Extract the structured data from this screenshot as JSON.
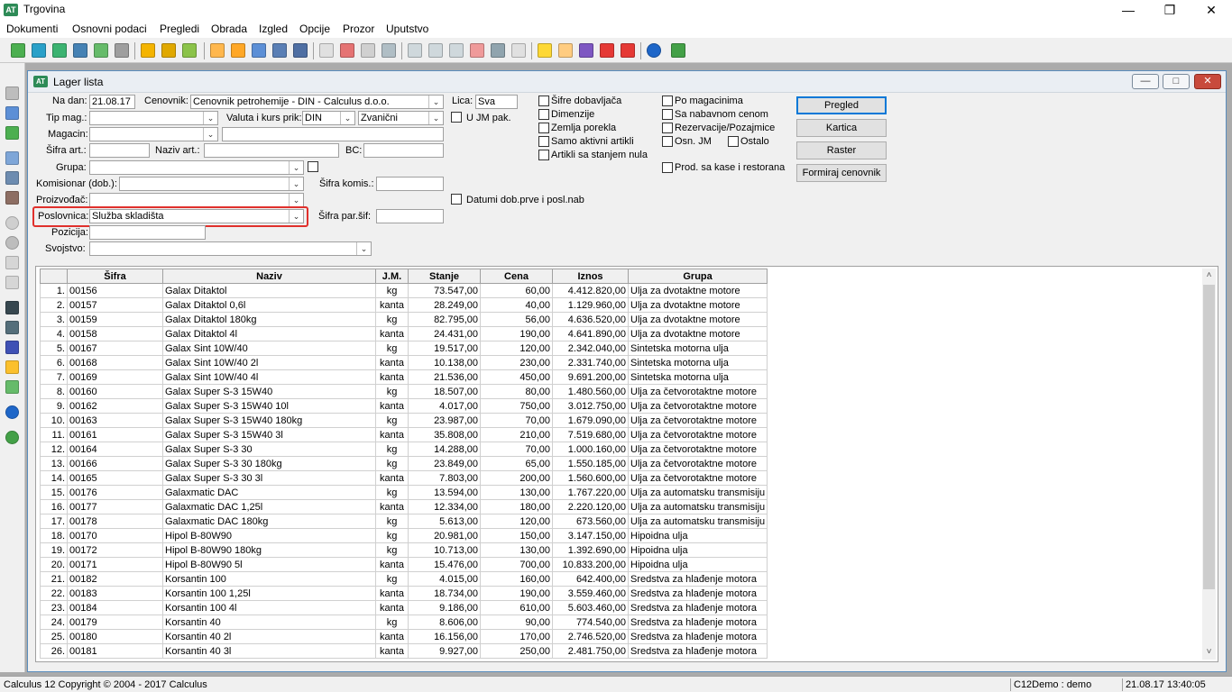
{
  "app": {
    "title": "Trgovina",
    "icon_text": "AT"
  },
  "menu": [
    "Dokumenti",
    "Osnovni podaci",
    "Pregledi",
    "Obrada",
    "Izgled",
    "Opcije",
    "Prozor",
    "Uputstvo"
  ],
  "child": {
    "title": "Lager lista"
  },
  "form": {
    "na_dan_label": "Na dan:",
    "na_dan_value": "21.08.17",
    "cenovnik_label": "Cenovnik:",
    "cenovnik_value": "Cenovnik petrohemije - DIN - Calculus d.o.o.",
    "lica_label": "Lica:",
    "lica_value": "Sva",
    "tip_mag_label": "Tip mag.:",
    "tip_mag_value": "",
    "valuta_label": "Valuta i kurs prik:",
    "valuta_value": "DIN",
    "kurs_value": "Zvanični",
    "u_jm_pak_label": "U JM pak.",
    "magacin_label": "Magacin:",
    "magacin_value": "",
    "sifra_art_label": "Šifra art.:",
    "naziv_art_label": "Naziv art.:",
    "bc_label": "BC:",
    "grupa_label": "Grupa:",
    "grupa_value": "",
    "komisionar_label": "Komisionar (dob.):",
    "komisionar_value": "",
    "sifra_komis_label": "Šifra komis.:",
    "proizvodjac_label": "Proizvođač:",
    "proizvodjac_value": "",
    "datumi_label": "Datumi dob.prve i posl.nab",
    "poslovnica_label": "Poslovnica:",
    "poslovnica_value": "Služba skladišta",
    "sifra_par_label": "Šifra par.šif:",
    "pozicija_label": "Pozicija:",
    "pozicija_value": "",
    "svojstvo_label": "Svojstvo:",
    "svojstvo_value": ""
  },
  "checks_col1": [
    "Šifre dobavljača",
    "Dimenzije",
    "Zemlja porekla",
    "Samo aktivni artikli",
    "Artikli sa stanjem nula"
  ],
  "checks_col2": [
    "Po magacinima",
    "Sa nabavnom cenom",
    "Rezervacije/Pozajmice",
    "Osn. JM",
    "Ostalo",
    "Prod. sa kase i restorana"
  ],
  "buttons": {
    "pregled": "Pregled",
    "kartica": "Kartica",
    "raster": "Raster",
    "formiraj": "Formiraj cenovnik"
  },
  "grid": {
    "columns": [
      "",
      "Šifra",
      "Naziv",
      "J.M.",
      "Stanje",
      "Cena",
      "Iznos",
      "Grupa"
    ],
    "rows": [
      [
        "1.",
        "00156",
        "Galax Ditaktol",
        "kg",
        "73.547,00",
        "60,00",
        "4.412.820,00",
        "Ulja za dvotaktne motore"
      ],
      [
        "2.",
        "00157",
        "Galax Ditaktol 0,6l",
        "kanta",
        "28.249,00",
        "40,00",
        "1.129.960,00",
        "Ulja za dvotaktne motore"
      ],
      [
        "3.",
        "00159",
        "Galax Ditaktol 180kg",
        "kg",
        "82.795,00",
        "56,00",
        "4.636.520,00",
        "Ulja za dvotaktne motore"
      ],
      [
        "4.",
        "00158",
        "Galax Ditaktol 4l",
        "kanta",
        "24.431,00",
        "190,00",
        "4.641.890,00",
        "Ulja za dvotaktne motore"
      ],
      [
        "5.",
        "00167",
        "Galax Sint 10W/40",
        "kg",
        "19.517,00",
        "120,00",
        "2.342.040,00",
        "Sintetska motorna ulja"
      ],
      [
        "6.",
        "00168",
        "Galax Sint 10W/40 2l",
        "kanta",
        "10.138,00",
        "230,00",
        "2.331.740,00",
        "Sintetska motorna ulja"
      ],
      [
        "7.",
        "00169",
        "Galax Sint 10W/40 4l",
        "kanta",
        "21.536,00",
        "450,00",
        "9.691.200,00",
        "Sintetska motorna ulja"
      ],
      [
        "8.",
        "00160",
        "Galax Super S-3 15W40",
        "kg",
        "18.507,00",
        "80,00",
        "1.480.560,00",
        "Ulja za četvorotaktne motore"
      ],
      [
        "9.",
        "00162",
        "Galax Super S-3 15W40 10l",
        "kanta",
        "4.017,00",
        "750,00",
        "3.012.750,00",
        "Ulja za četvorotaktne motore"
      ],
      [
        "10.",
        "00163",
        "Galax Super S-3 15W40 180kg",
        "kg",
        "23.987,00",
        "70,00",
        "1.679.090,00",
        "Ulja za četvorotaktne motore"
      ],
      [
        "11.",
        "00161",
        "Galax Super S-3 15W40 3l",
        "kanta",
        "35.808,00",
        "210,00",
        "7.519.680,00",
        "Ulja za četvorotaktne motore"
      ],
      [
        "12.",
        "00164",
        "Galax Super S-3 30",
        "kg",
        "14.288,00",
        "70,00",
        "1.000.160,00",
        "Ulja za četvorotaktne motore"
      ],
      [
        "13.",
        "00166",
        "Galax Super S-3 30 180kg",
        "kg",
        "23.849,00",
        "65,00",
        "1.550.185,00",
        "Ulja za četvorotaktne motore"
      ],
      [
        "14.",
        "00165",
        "Galax Super S-3 30 3l",
        "kanta",
        "7.803,00",
        "200,00",
        "1.560.600,00",
        "Ulja za četvorotaktne motore"
      ],
      [
        "15.",
        "00176",
        "Galaxmatic DAC",
        "kg",
        "13.594,00",
        "130,00",
        "1.767.220,00",
        "Ulja za automatsku transmisiju"
      ],
      [
        "16.",
        "00177",
        "Galaxmatic DAC 1,25l",
        "kanta",
        "12.334,00",
        "180,00",
        "2.220.120,00",
        "Ulja za automatsku transmisiju"
      ],
      [
        "17.",
        "00178",
        "Galaxmatic DAC 180kg",
        "kg",
        "5.613,00",
        "120,00",
        "673.560,00",
        "Ulja za automatsku transmisiju"
      ],
      [
        "18.",
        "00170",
        "Hipol B-80W90",
        "kg",
        "20.981,00",
        "150,00",
        "3.147.150,00",
        "Hipoidna ulja"
      ],
      [
        "19.",
        "00172",
        "Hipol B-80W90 180kg",
        "kg",
        "10.713,00",
        "130,00",
        "1.392.690,00",
        "Hipoidna ulja"
      ],
      [
        "20.",
        "00171",
        "Hipol B-80W90 5l",
        "kanta",
        "15.476,00",
        "700,00",
        "10.833.200,00",
        "Hipoidna ulja"
      ],
      [
        "21.",
        "00182",
        "Korsantin 100",
        "kg",
        "4.015,00",
        "160,00",
        "642.400,00",
        "Sredstva za hlađenje motora"
      ],
      [
        "22.",
        "00183",
        "Korsantin 100 1,25l",
        "kanta",
        "18.734,00",
        "190,00",
        "3.559.460,00",
        "Sredstva za hlađenje motora"
      ],
      [
        "23.",
        "00184",
        "Korsantin 100 4l",
        "kanta",
        "9.186,00",
        "610,00",
        "5.603.460,00",
        "Sredstva za hlađenje motora"
      ],
      [
        "24.",
        "00179",
        "Korsantin 40",
        "kg",
        "8.606,00",
        "90,00",
        "774.540,00",
        "Sredstva za hlađenje motora"
      ],
      [
        "25.",
        "00180",
        "Korsantin 40 2l",
        "kanta",
        "16.156,00",
        "170,00",
        "2.746.520,00",
        "Sredstva za hlađenje motora"
      ],
      [
        "26.",
        "00181",
        "Korsantin 40 3l",
        "kanta",
        "9.927,00",
        "250,00",
        "2.481.750,00",
        "Sredstva za hlađenje motora"
      ]
    ]
  },
  "status": {
    "copyright": "Calculus 12  Copyright © 2004 - 2017  Calculus",
    "user": "C12Demo : demo",
    "datetime": "21.08.17 13:40:05"
  },
  "colors": {
    "highlight_border": "#e0302c",
    "default_button_border": "#0078d7"
  }
}
